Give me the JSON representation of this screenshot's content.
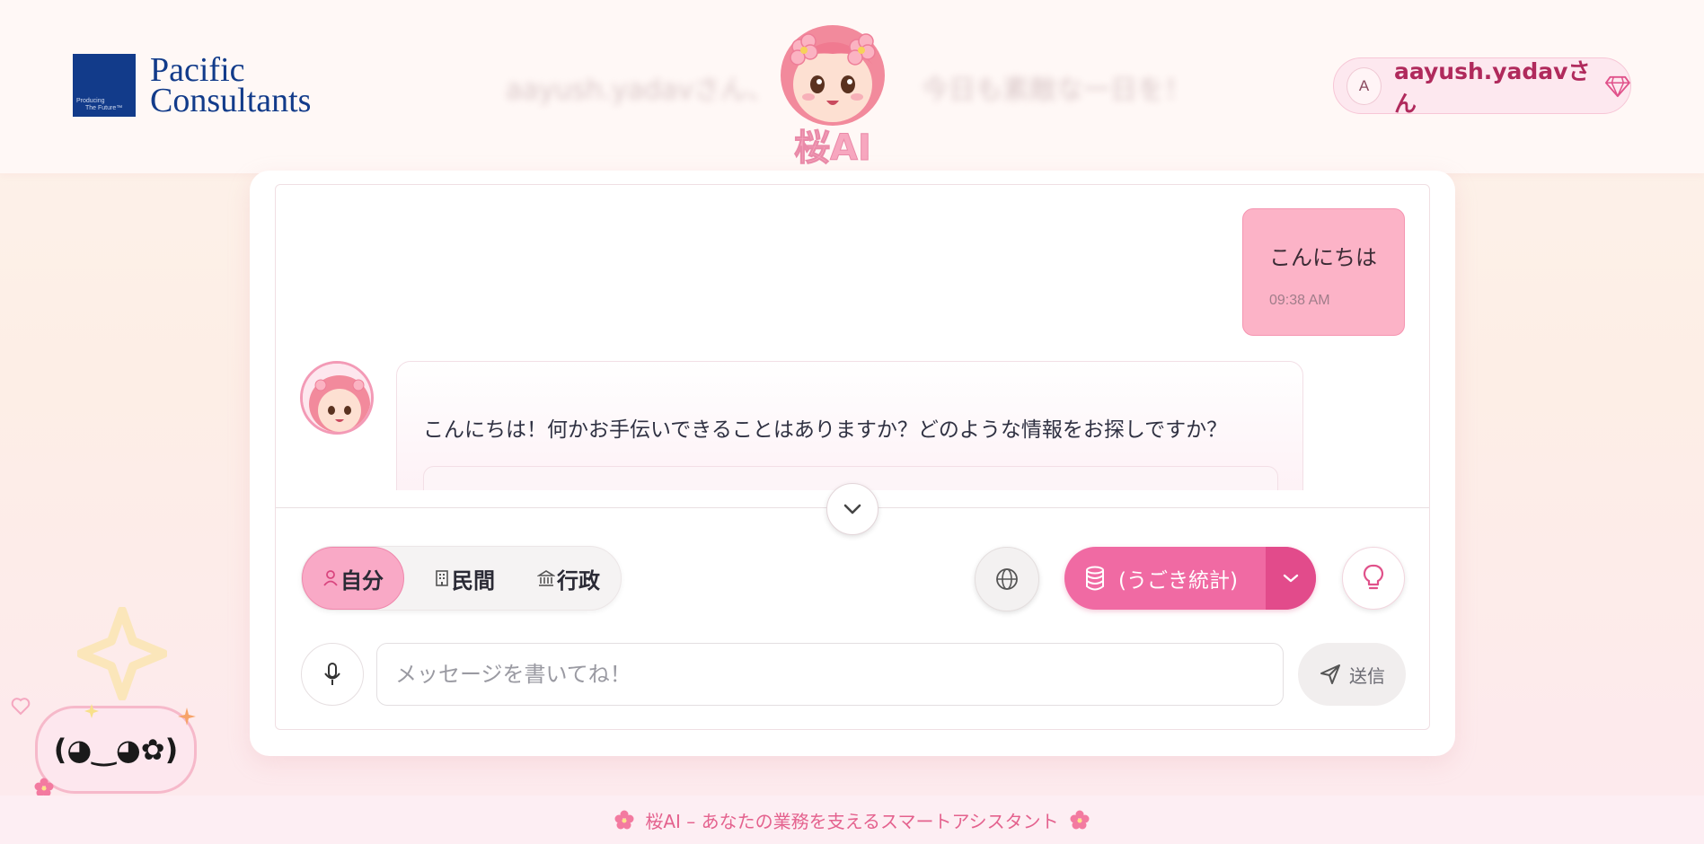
{
  "header": {
    "logo_line1": "Pacific",
    "logo_line2": "Consultants",
    "logo_tagline1": "Producing",
    "logo_tagline2": "The Future™",
    "blurred_greeting_left": "aayush.yadavさん、",
    "blurred_greeting_right": "今日も素敵な一日を！",
    "mascot_title": "桜AI",
    "user": {
      "avatar_letter": "A",
      "name": "aayush.yadavさん",
      "badge_icon": "gem-icon"
    }
  },
  "chat": {
    "messages": [
      {
        "role": "user",
        "text": "こんにちは",
        "time": "09:38 AM"
      },
      {
        "role": "assistant",
        "text": "こんにちは！何かお手伝いできることはありますか？どのような情報をお探しですか？"
      }
    ]
  },
  "controls": {
    "scope_options": [
      {
        "label": "自分",
        "icon": "person-icon",
        "active": true
      },
      {
        "label": "民間",
        "icon": "building-icon",
        "active": false
      },
      {
        "label": "行政",
        "icon": "government-icon",
        "active": false
      }
    ],
    "database_select": "(うごき統計)",
    "input_placeholder": "メッセージを書いてね！",
    "send_label": "送信"
  },
  "decor": {
    "kaomoji": "(◕‿◕✿)"
  },
  "footer": {
    "text": "桜AI – あなたの業務を支えるスマートアシスタント"
  },
  "colors": {
    "accent_pink": "#f06aa3",
    "accent_dark_pink": "#e24b8b",
    "user_bubble": "#fcb3c7",
    "logo_navy": "#123b8a"
  }
}
